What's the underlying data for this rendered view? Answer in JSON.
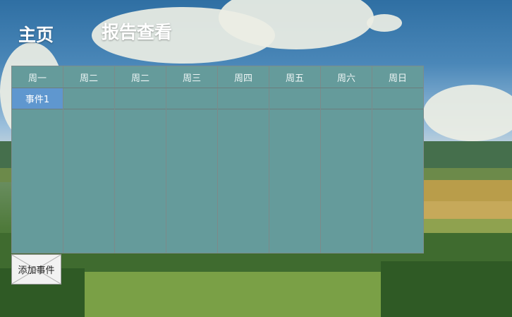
{
  "nav": {
    "home": "主页",
    "report": "报告查看"
  },
  "calendar": {
    "days": [
      "周一",
      "周二",
      "周二",
      "周三",
      "周四",
      "周五",
      "周六",
      "周日"
    ],
    "events": [
      {
        "day_index": 0,
        "slot": 0,
        "label": "事件1",
        "color": "#5f97cf"
      }
    ]
  },
  "actions": {
    "add_event": "添加事件"
  }
}
